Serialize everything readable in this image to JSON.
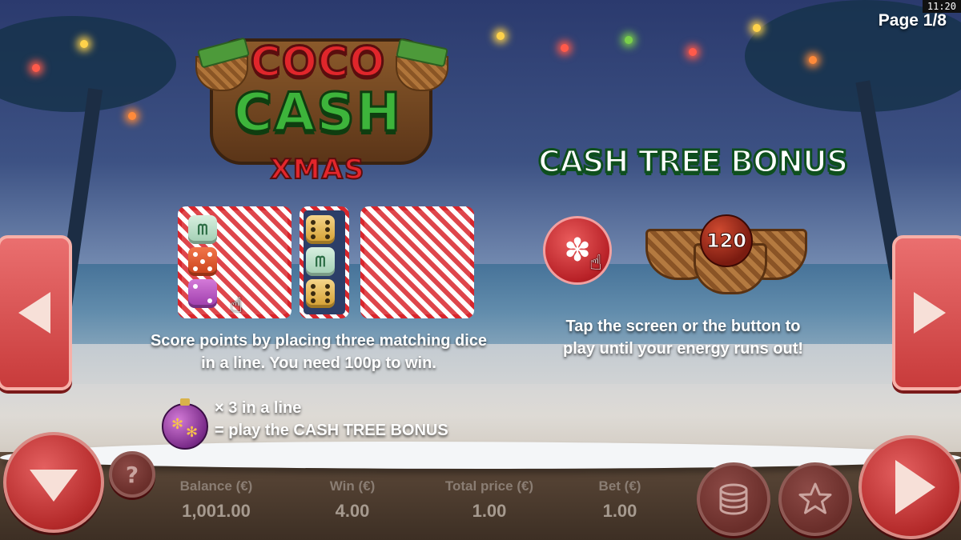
{
  "clock": "11:20",
  "page_indicator": "Page 1/8",
  "logo": {
    "line1": "COCO",
    "line2": "CASH",
    "line3": "XMAS"
  },
  "left_panel": {
    "description_line1": "Score points by placing three matching dice",
    "description_line2": "in a line. You need 100p to win.",
    "ornament_line1": "× 3 in a line",
    "ornament_line2": "= play the CASH TREE BONUS"
  },
  "right_panel": {
    "title": "CASH TREE BONUS",
    "bonus_value": "120",
    "description_line1": "Tap the screen or the button to",
    "description_line2": "play until your energy runs out!"
  },
  "bottom_bar": {
    "help_symbol": "?",
    "stats": [
      {
        "label": "Balance (€)",
        "value": "1,001.00"
      },
      {
        "label": "Win (€)",
        "value": "4.00"
      },
      {
        "label": "Total price (€)",
        "value": "1.00"
      },
      {
        "label": "Bet (€)",
        "value": "1.00"
      }
    ]
  },
  "icons": {
    "prev": "triangle-left",
    "next": "triangle-right",
    "menu": "chevron-down",
    "coins": "coin-stack",
    "favorite": "star",
    "play": "play-triangle"
  },
  "colors": {
    "accent_red": "#c83b3b",
    "logo_green": "#3db43b",
    "title_outline": "#0e4f1e"
  }
}
